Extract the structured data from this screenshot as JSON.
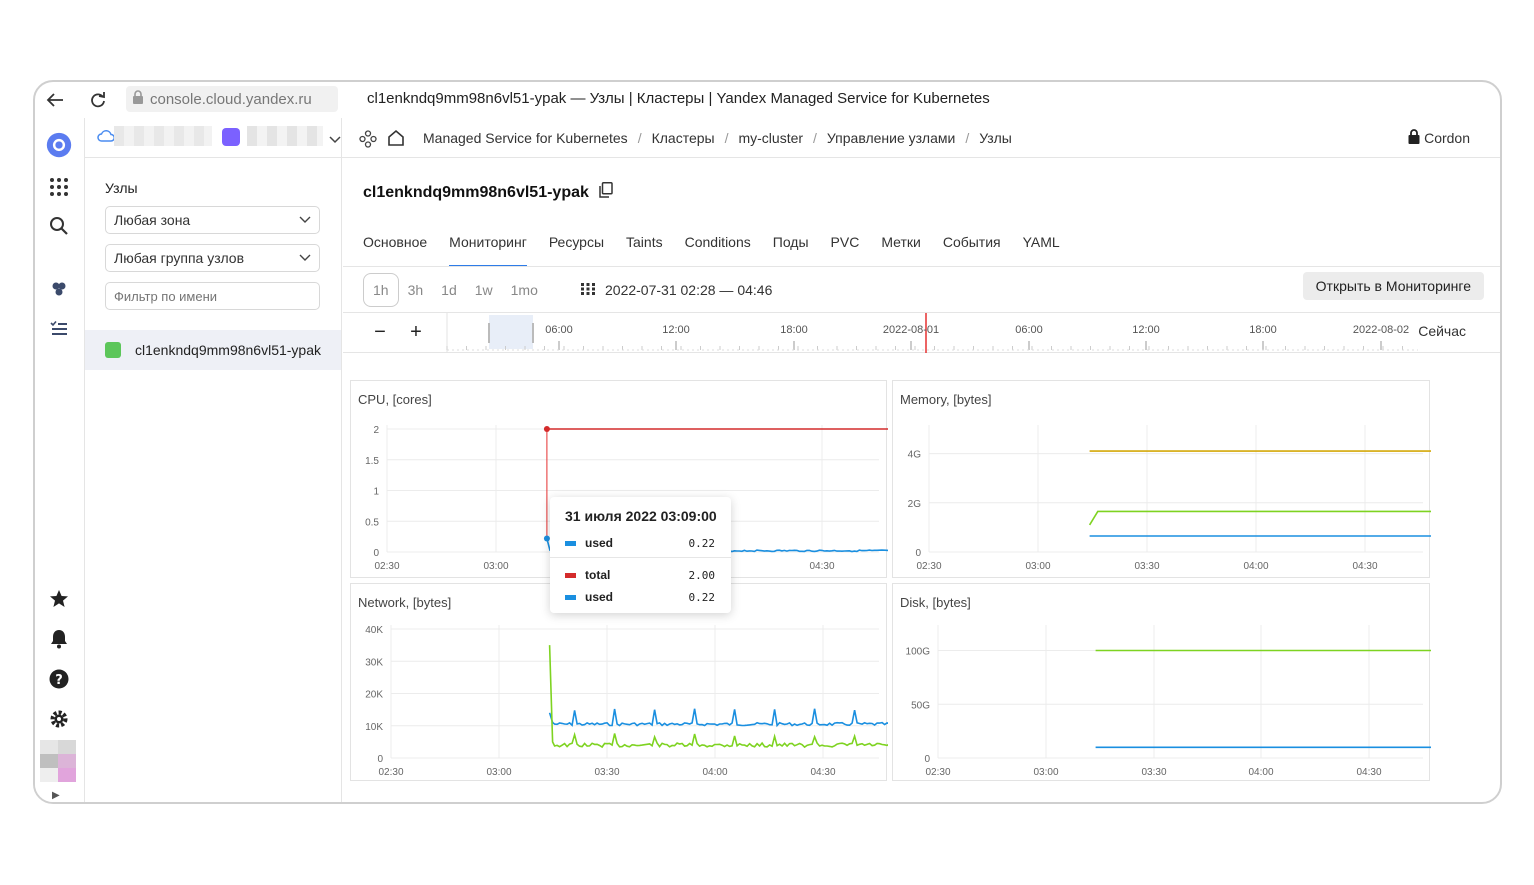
{
  "browser": {
    "url": "console.cloud.yandex.ru",
    "title": "cl1enkndq9mm98n6vl51-ypak — Узлы | Кластеры | Yandex Managed Service for Kubernetes"
  },
  "breadcrumbs": [
    "Managed Service for Kubernetes",
    "Кластеры",
    "my-cluster",
    "Управление узлами",
    "Узлы"
  ],
  "header_right": {
    "label": "Cordon"
  },
  "nodes_panel": {
    "title": "Узлы",
    "zone_select": "Любая зона",
    "group_select": "Любая группа узлов",
    "filter_placeholder": "Фильтр по имени",
    "node_name": "cl1enkndq9mm98n6vl51-ypak"
  },
  "resource_title": "cl1enkndq9mm98n6vl51-ypak",
  "tabs": [
    "Основное",
    "Мониторинг",
    "Ресурсы",
    "Taints",
    "Conditions",
    "Поды",
    "PVC",
    "Метки",
    "События",
    "YAML"
  ],
  "active_tab": "Мониторинг",
  "range_buttons": [
    "1h",
    "3h",
    "1d",
    "1w",
    "1mo"
  ],
  "active_range": "1h",
  "range_label": "2022-07-31 02:28 — 04:46",
  "open_button": "Открыть в Мониторинге",
  "timeline": {
    "ticks": [
      "06:00",
      "12:00",
      "18:00",
      "2022-08-01",
      "06:00",
      "12:00",
      "18:00",
      "2022-08-02"
    ],
    "now_label": "Сейчас",
    "minus": "−",
    "plus": "+"
  },
  "colors": {
    "accent": "#2e7ce8",
    "used": "#1a8fe0",
    "total": "#d42b2b",
    "green": "#7ed321",
    "yellow": "#d4a80a",
    "marker": "#e53030"
  },
  "chart_data": [
    {
      "type": "line",
      "title": "CPU, [cores]",
      "x_ticks": [
        "02:30",
        "03:00",
        "04:30"
      ],
      "y_ticks": [
        "2",
        "1.5",
        "1",
        "0.5",
        "0"
      ],
      "ylim": [
        0,
        2
      ],
      "series": [
        {
          "name": "total",
          "x": [
            "03:09",
            "04:46"
          ],
          "values": [
            2.0,
            2.0
          ]
        },
        {
          "name": "used",
          "x": [
            "03:09",
            "04:46"
          ],
          "values": [
            0.22,
            0.02
          ]
        }
      ]
    },
    {
      "type": "line",
      "title": "Memory, [bytes]",
      "x_ticks": [
        "02:30",
        "03:00",
        "03:30",
        "04:00",
        "04:30"
      ],
      "y_ticks": [
        "4G",
        "2G",
        "0"
      ],
      "ylim": [
        0,
        5
      ],
      "series": [
        {
          "x": [
            "03:09",
            "04:46"
          ],
          "values": [
            4.1,
            4.1
          ]
        },
        {
          "x": [
            "03:09",
            "03:11",
            "04:46"
          ],
          "values": [
            1.1,
            1.65,
            1.65
          ]
        },
        {
          "x": [
            "03:09",
            "04:46"
          ],
          "values": [
            0.65,
            0.65
          ]
        }
      ]
    },
    {
      "type": "line",
      "title": "Network, [bytes]",
      "x_ticks": [
        "02:30",
        "03:00",
        "03:30",
        "04:00",
        "04:30"
      ],
      "y_ticks": [
        "40K",
        "30K",
        "20K",
        "10K",
        "0"
      ],
      "ylim": [
        0,
        40
      ],
      "series": [
        {
          "x": [
            "03:09",
            "03:10",
            "04:46"
          ],
          "values": [
            14,
            11,
            10.5
          ]
        },
        {
          "x": [
            "03:09",
            "03:10",
            "04:46"
          ],
          "values": [
            35,
            5,
            4
          ]
        }
      ]
    },
    {
      "type": "line",
      "title": "Disk, [bytes]",
      "x_ticks": [
        "02:30",
        "03:00",
        "03:30",
        "04:00",
        "04:30"
      ],
      "y_ticks": [
        "100G",
        "50G",
        "0"
      ],
      "ylim": [
        0,
        120
      ],
      "series": [
        {
          "x": [
            "03:09",
            "04:46"
          ],
          "values": [
            100,
            100
          ]
        },
        {
          "x": [
            "03:09",
            "04:46"
          ],
          "values": [
            10,
            10
          ]
        }
      ]
    }
  ],
  "tooltip": {
    "title": "31 июля 2022 03:09:00",
    "rows": [
      {
        "name": "used",
        "value": "0.22"
      },
      {
        "name": "total",
        "value": "2.00"
      },
      {
        "name": "used",
        "value": "0.22"
      }
    ]
  }
}
